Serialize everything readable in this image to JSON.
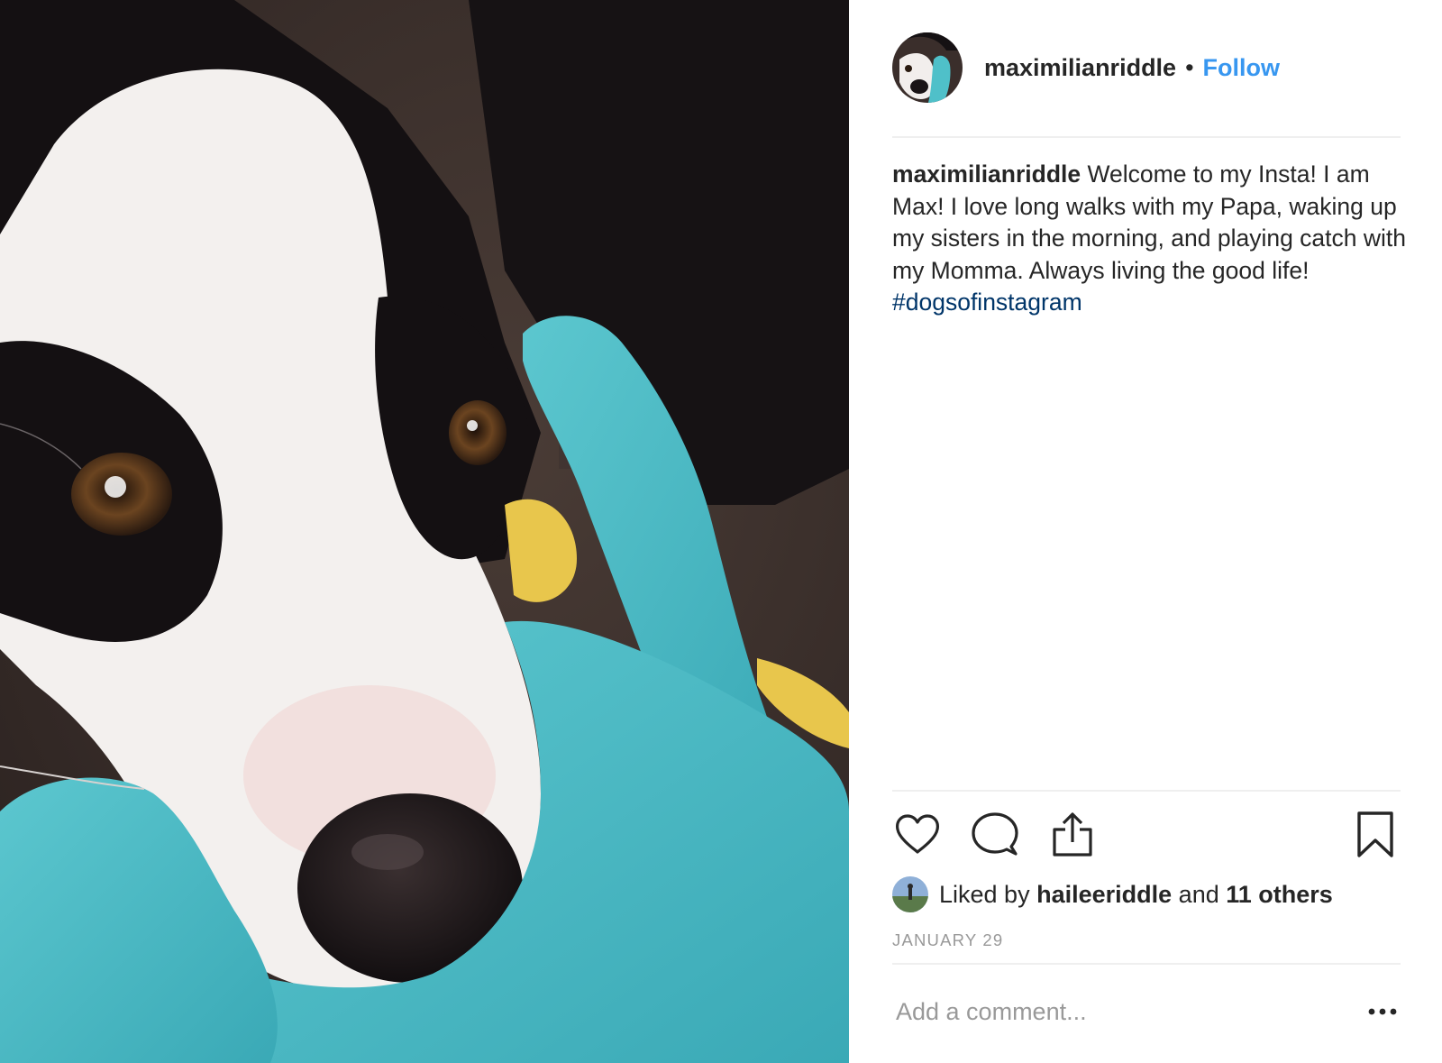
{
  "post": {
    "author": "maximilianriddle",
    "follow_label": "Follow",
    "header_dot": "•",
    "photo_alt": "dog-photo",
    "caption": {
      "username": "maximilianriddle",
      "text": "Welcome to my Insta! I am Max! I love long walks with my Papa, waking up my sisters in the morning, and playing catch with my Momma. Always living the good life!",
      "hashtag": "#dogsofinstagram"
    },
    "actions": {
      "like_icon": "heart-icon",
      "comment_icon": "comment-bubble-icon",
      "share_icon": "share-upload-icon",
      "save_icon": "bookmark-icon"
    },
    "likes": {
      "prefix": "Liked by",
      "liker": "haileeriddle",
      "conj": "and",
      "others": "11 others"
    },
    "date": "JANUARY 29",
    "comment": {
      "placeholder": "Add a comment...",
      "more_icon": "more-options-icon"
    }
  },
  "colors": {
    "link_blue": "#3897f0",
    "hashtag_blue": "#003569",
    "text": "#262626",
    "muted": "#999999",
    "divider": "#efefef"
  }
}
